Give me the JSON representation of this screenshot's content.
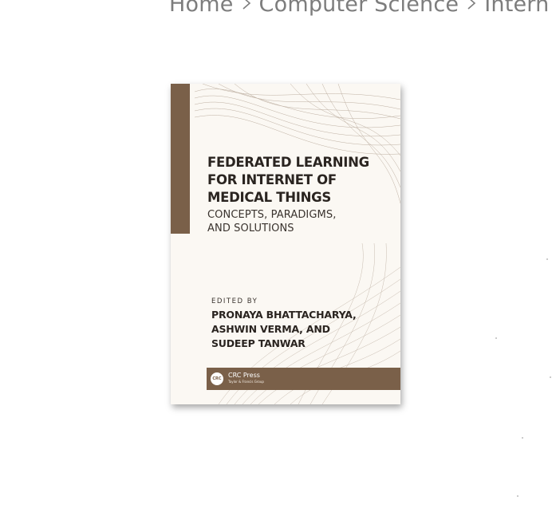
{
  "breadcrumb": {
    "items": [
      "Home",
      "Computer Science",
      "Intern"
    ]
  },
  "book": {
    "title_lines": [
      "FEDERATED LEARNING",
      "FOR INTERNET OF",
      "MEDICAL THINGS"
    ],
    "subtitle_lines": [
      "CONCEPTS, PARADIGMS,",
      "AND SOLUTIONS"
    ],
    "edited_by": "EDITED BY",
    "author_lines": [
      "PRONAYA BHATTACHARYA,",
      "ASHWIN VERMA, AND",
      "SUDEEP TANWAR"
    ],
    "publisher_logo": "CRC",
    "publisher_name": "CRC Press",
    "publisher_tagline": "Taylor & Francis Group"
  },
  "colors": {
    "breadcrumb_text": "#7d7d7d",
    "cover_background": "#fbf8f3",
    "cover_accent": "#7a6049"
  }
}
